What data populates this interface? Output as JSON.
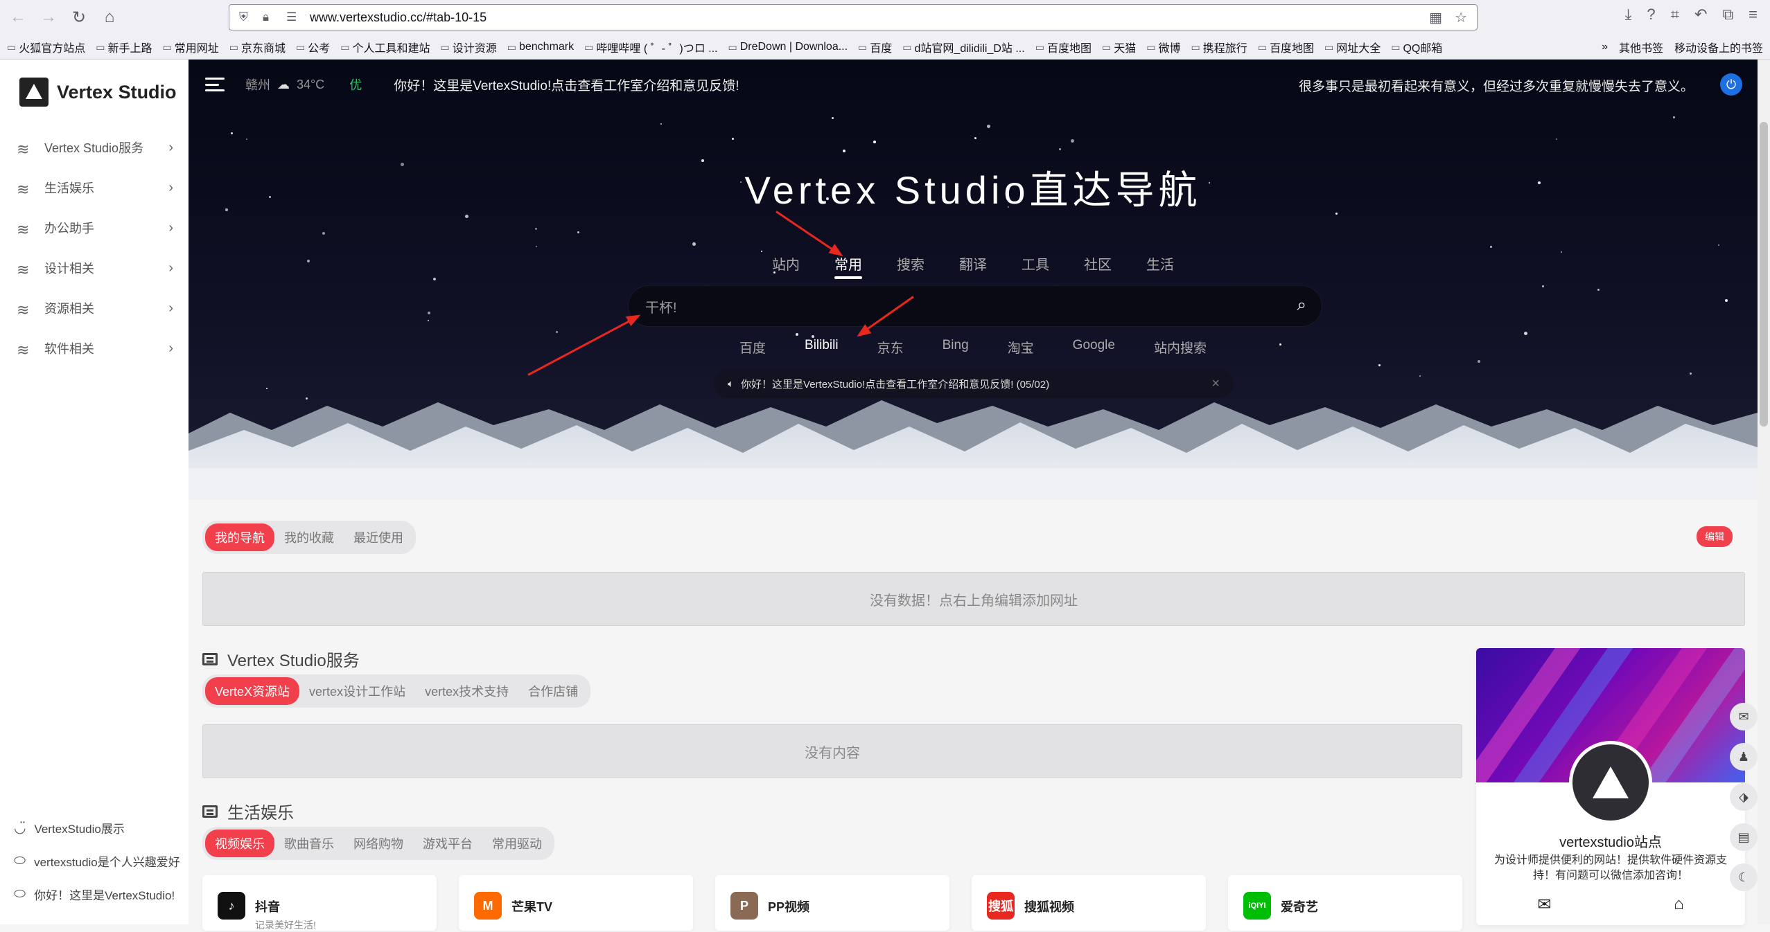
{
  "browser": {
    "url": "www.vertexstudio.cc/#tab-10-15",
    "bookmarks": [
      "火狐官方站点",
      "新手上路",
      "常用网址",
      "京东商城",
      "公考",
      "个人工具和建站",
      "设计资源",
      "benchmark",
      "哔哩哔哩 ( ゜- ゜)つロ ...",
      "DreDown | Downloa...",
      "百度",
      "d站官网_dilidili_D站 ...",
      "百度地图",
      "天猫",
      "微博",
      "携程旅行",
      "百度地图",
      "网址大全",
      "QQ邮箱"
    ],
    "bookmarks_right": [
      "其他书签",
      "移动设备上的书签"
    ]
  },
  "sidebar": {
    "logo": "Vertex Studio",
    "items": [
      {
        "label": "Vertex Studio服务"
      },
      {
        "label": "生活娱乐"
      },
      {
        "label": "办公助手"
      },
      {
        "label": "设计相关"
      },
      {
        "label": "资源相关"
      },
      {
        "label": "软件相关"
      }
    ],
    "bottom": [
      {
        "label": "VertexStudio展示"
      },
      {
        "label": "vertexstudio是个人兴趣爱好"
      },
      {
        "label": "你好！这里是VertexStudio!"
      }
    ]
  },
  "hero": {
    "city": "赣州",
    "temperature": "34°C",
    "aqi": "优",
    "notice": "你好！这里是VertexStudio!点击查看工作室介绍和意见反馈!",
    "quote": "很多事只是最初看起来有意义，但经过多次重复就慢慢失去了意义。",
    "title": "Vertex Studio直达导航",
    "tabs": [
      "站内",
      "常用",
      "搜索",
      "翻译",
      "工具",
      "社区",
      "生活"
    ],
    "active_tab": "常用",
    "search_placeholder": "干杯!",
    "engines": [
      "百度",
      "Bilibili",
      "京东",
      "Bing",
      "淘宝",
      "Google",
      "站内搜索"
    ],
    "active_engine": "Bilibili",
    "announcement": "你好！这里是VertexStudio!点击查看工作室介绍和意见反馈!  (05/02)"
  },
  "main": {
    "nav_tabs": [
      "我的导航",
      "我的收藏",
      "最近使用"
    ],
    "edit_label": "编辑",
    "empty_nav": "没有数据！点右上角编辑添加网址",
    "section1": {
      "title": "Vertex Studio服务",
      "tabs": [
        "VerteX资源站",
        "vertex设计工作站",
        "vertex技术支持",
        "合作店铺"
      ],
      "empty": "没有内容"
    },
    "section2": {
      "title": "生活娱乐",
      "tabs": [
        "视频娱乐",
        "歌曲音乐",
        "网络购物",
        "游戏平台",
        "常用驱动"
      ]
    },
    "cards": [
      {
        "name": "抖音",
        "sub": "记录美好生活!",
        "icon_color": "#111111",
        "glyph": "♪"
      },
      {
        "name": "芒果TV",
        "sub": "",
        "icon_color": "#ff6a00",
        "glyph": "M"
      },
      {
        "name": "PP视频",
        "sub": "",
        "icon_color": "#8b6a55",
        "glyph": "P"
      },
      {
        "name": "搜狐视频",
        "sub": "",
        "icon_color": "#e8281f",
        "glyph": "搜狐"
      },
      {
        "name": "爱奇艺",
        "sub": "",
        "icon_color": "#00be06",
        "glyph": "iQIYI"
      }
    ]
  },
  "profile": {
    "name": "vertexstudio站点",
    "desc": "为设计师提供便利的网站！提供软件硬件资源支持！有问题可以微信添加咨询！"
  }
}
